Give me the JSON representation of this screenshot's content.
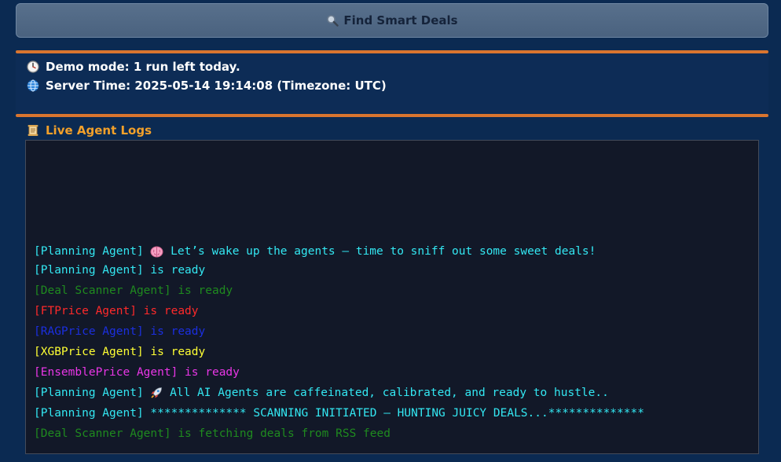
{
  "find_button": {
    "icon": "magnifier-icon",
    "label": "Find Smart Deals"
  },
  "status": {
    "demo_icon": "clock-icon",
    "demo_text": "Demo mode: 1 run left today.",
    "server_icon": "globe-icon",
    "server_text": "Server Time: 2025-05-14 19:14:08 (Timezone: UTC)"
  },
  "logs": {
    "title_icon": "scroll-icon",
    "title": "Live Agent Logs",
    "lines": [
      {
        "pre": "[Planning Agent] ",
        "icon": "brain-icon",
        "text": " Let’s wake up the agents — time to sniff out some sweet deals!",
        "color": "#33e7f2"
      },
      {
        "pre": "",
        "icon": "",
        "text": "[Planning Agent] is ready",
        "color": "#33e7f2"
      },
      {
        "pre": "",
        "icon": "",
        "text": "[Deal Scanner Agent] is ready",
        "color": "#1f8a1f"
      },
      {
        "pre": "",
        "icon": "",
        "text": "[FTPrice Agent] is ready",
        "color": "#ff2a2a"
      },
      {
        "pre": "",
        "icon": "",
        "text": "[RAGPrice Agent] is ready",
        "color": "#1b2fe0"
      },
      {
        "pre": "",
        "icon": "",
        "text": "[XGBPrice Agent] is ready",
        "color": "#ffff33"
      },
      {
        "pre": "",
        "icon": "",
        "text": "[EnsemblePrice Agent] is ready",
        "color": "#e936e6"
      },
      {
        "pre": "[Planning Agent] ",
        "icon": "rocket-icon",
        "text": " All AI Agents are caffeinated, calibrated, and ready to hustle..",
        "color": "#33e7f2"
      },
      {
        "pre": "",
        "icon": "",
        "text": "[Planning Agent] ************** SCANNING INITIATED — HUNTING JUICY DEALS...**************",
        "color": "#33e7f2"
      },
      {
        "pre": "",
        "icon": "",
        "text": "[Deal Scanner Agent] is fetching deals from RSS feed",
        "color": "#1f8a1f"
      }
    ]
  }
}
